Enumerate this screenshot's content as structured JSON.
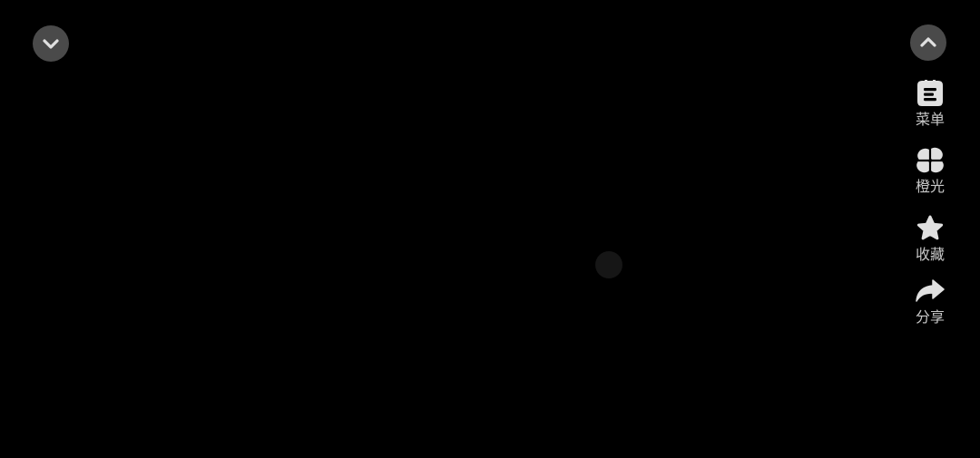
{
  "colors": {
    "background": "#000000",
    "button_bg": "#4a4a4a",
    "icon": "#e0e0e0",
    "label": "#c8c8c8",
    "loading_dot": "#161616"
  },
  "controls": {
    "collapse_icon": "chevron-down-icon",
    "expand_icon": "chevron-up-icon"
  },
  "sidebar": {
    "items": [
      {
        "label": "菜单",
        "icon": "menu-icon"
      },
      {
        "label": "橙光",
        "icon": "orange-light-icon"
      },
      {
        "label": "收藏",
        "icon": "star-icon"
      },
      {
        "label": "分享",
        "icon": "share-icon"
      }
    ]
  }
}
